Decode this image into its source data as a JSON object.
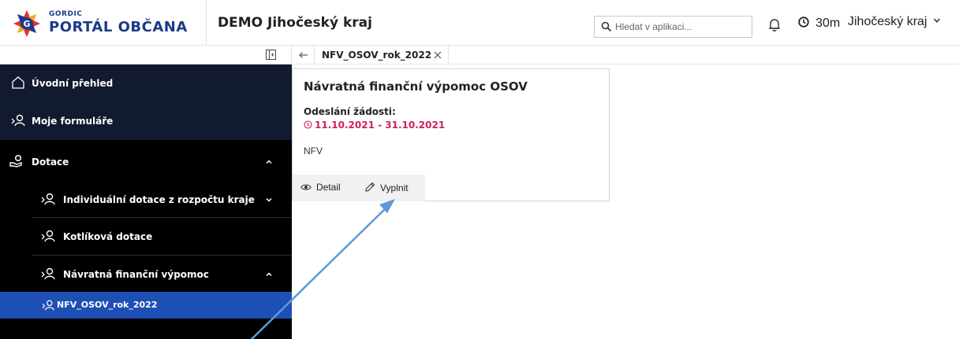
{
  "header": {
    "brand_small": "GORDIC",
    "brand_name": "PORTÁL OBČANA",
    "app_title": "DEMO Jihočeský kraj",
    "search_placeholder": "Hledat v aplikaci...",
    "timer": "30m",
    "region": "Jihočeský kraj"
  },
  "sidebar": {
    "items": [
      {
        "label": "Úvodní přehled",
        "icon": "home-icon"
      },
      {
        "label": "Moje formuláře",
        "icon": "user-path-icon"
      },
      {
        "label": "Dotace",
        "icon": "hand-money-icon",
        "expanded": true
      },
      {
        "label": "Individuální dotace z rozpočtu kraje",
        "icon": "user-path-icon",
        "expanded": false
      },
      {
        "label": "Kotlíková dotace",
        "icon": "user-path-icon"
      },
      {
        "label": "Návratná finanční výpomoc",
        "icon": "user-path-icon",
        "expanded": true
      }
    ],
    "active_item": {
      "label": "NFV_OSOV_rok_2022",
      "icon": "user-path-icon"
    }
  },
  "tabs": [
    {
      "label": "NFV_OSOV_rok_2022",
      "active": true
    }
  ],
  "card": {
    "title": "Návratná finanční výpomoc OSOV",
    "subtitle": "Odeslání žádosti:",
    "date_range": "11.10.2021 - 31.10.2021",
    "code": "NFV",
    "actions": [
      {
        "label": "Detail",
        "icon": "eye-icon"
      },
      {
        "label": "Vyplnit",
        "icon": "pencil-icon"
      }
    ]
  },
  "colors": {
    "brand": "#1a3a8a",
    "sidebar_bg": "#000000",
    "sidebar_top_bg": "#111a2e",
    "active_bg": "#1e4fb5",
    "date_accent": "#d0205a",
    "arrow": "#5b9bd5"
  }
}
